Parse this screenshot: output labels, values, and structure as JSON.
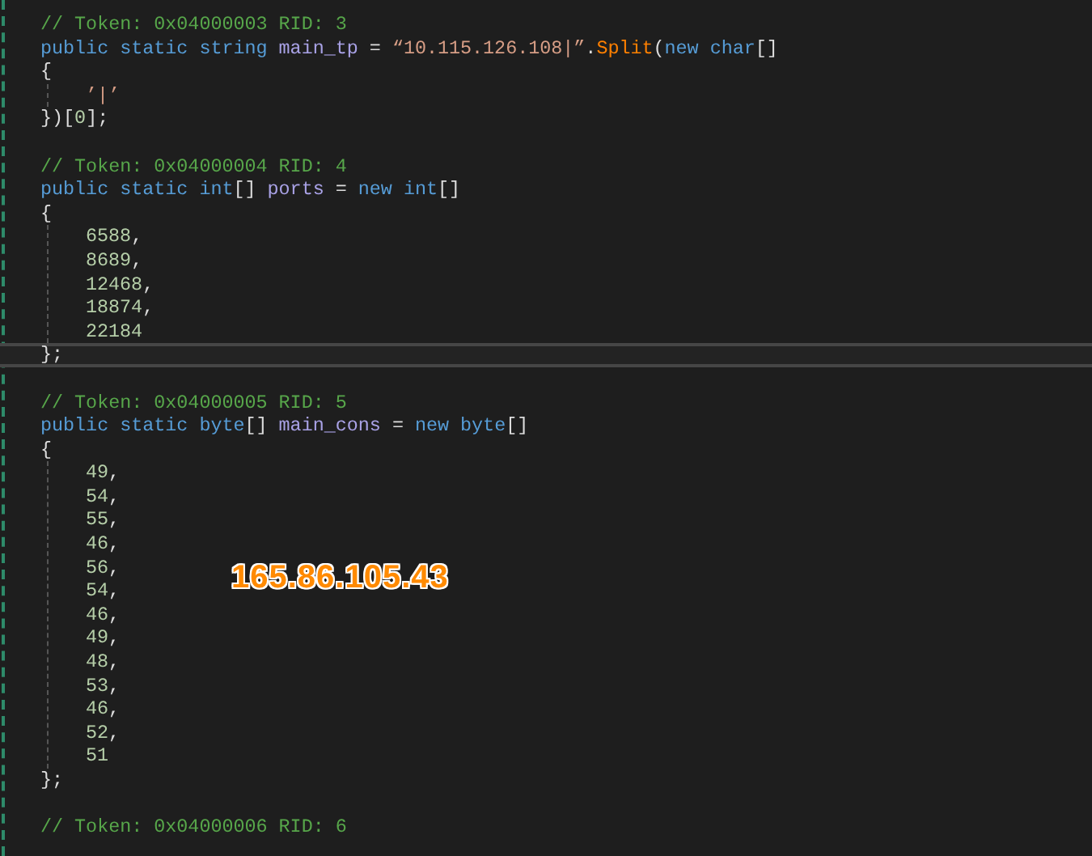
{
  "editor": {
    "blocks": [
      {
        "comment": "// Token: 0x04000003 RID: 3",
        "current": false,
        "declaration": [
          {
            "kind": "keyword",
            "text": "public static string "
          },
          {
            "kind": "field",
            "text": "main_tp "
          },
          {
            "kind": "punct",
            "text": "= "
          },
          {
            "kind": "string",
            "text": "“10.115.126.108|”"
          },
          {
            "kind": "punct",
            "text": "."
          },
          {
            "kind": "method",
            "text": "Split"
          },
          {
            "kind": "punct",
            "text": "("
          },
          {
            "kind": "keyword",
            "text": "new char"
          },
          {
            "kind": "punct",
            "text": "[]"
          }
        ],
        "open": "{",
        "items": [
          [
            {
              "kind": "string",
              "text": "’|’"
            }
          ]
        ],
        "close": [
          {
            "kind": "punct",
            "text": "})["
          },
          {
            "kind": "number",
            "text": "0"
          },
          {
            "kind": "punct",
            "text": "];"
          }
        ]
      },
      {
        "comment": "// Token: 0x04000004 RID: 4",
        "current": true,
        "declaration": [
          {
            "kind": "keyword",
            "text": "public static int"
          },
          {
            "kind": "punct",
            "text": "[] "
          },
          {
            "kind": "field",
            "text": "ports "
          },
          {
            "kind": "punct",
            "text": "= "
          },
          {
            "kind": "keyword",
            "text": "new int"
          },
          {
            "kind": "punct",
            "text": "[]"
          }
        ],
        "open": "{",
        "items": [
          [
            {
              "kind": "number",
              "text": "6588"
            },
            {
              "kind": "punct",
              "text": ","
            }
          ],
          [
            {
              "kind": "number",
              "text": "8689"
            },
            {
              "kind": "punct",
              "text": ","
            }
          ],
          [
            {
              "kind": "number",
              "text": "12468"
            },
            {
              "kind": "punct",
              "text": ","
            }
          ],
          [
            {
              "kind": "number",
              "text": "18874"
            },
            {
              "kind": "punct",
              "text": ","
            }
          ],
          [
            {
              "kind": "number",
              "text": "22184"
            }
          ]
        ],
        "close": [
          {
            "kind": "punct",
            "text": "};"
          }
        ]
      },
      {
        "comment": "// Token: 0x04000005 RID: 5",
        "current": false,
        "declaration": [
          {
            "kind": "keyword",
            "text": "public static byte"
          },
          {
            "kind": "punct",
            "text": "[] "
          },
          {
            "kind": "field",
            "text": "main_cons "
          },
          {
            "kind": "punct",
            "text": "= "
          },
          {
            "kind": "keyword",
            "text": "new byte"
          },
          {
            "kind": "punct",
            "text": "[]"
          }
        ],
        "open": "{",
        "items": [
          [
            {
              "kind": "number",
              "text": "49"
            },
            {
              "kind": "punct",
              "text": ","
            }
          ],
          [
            {
              "kind": "number",
              "text": "54"
            },
            {
              "kind": "punct",
              "text": ","
            }
          ],
          [
            {
              "kind": "number",
              "text": "55"
            },
            {
              "kind": "punct",
              "text": ","
            }
          ],
          [
            {
              "kind": "number",
              "text": "46"
            },
            {
              "kind": "punct",
              "text": ","
            }
          ],
          [
            {
              "kind": "number",
              "text": "56"
            },
            {
              "kind": "punct",
              "text": ","
            }
          ],
          [
            {
              "kind": "number",
              "text": "54"
            },
            {
              "kind": "punct",
              "text": ","
            }
          ],
          [
            {
              "kind": "number",
              "text": "46"
            },
            {
              "kind": "punct",
              "text": ","
            }
          ],
          [
            {
              "kind": "number",
              "text": "49"
            },
            {
              "kind": "punct",
              "text": ","
            }
          ],
          [
            {
              "kind": "number",
              "text": "48"
            },
            {
              "kind": "punct",
              "text": ","
            }
          ],
          [
            {
              "kind": "number",
              "text": "53"
            },
            {
              "kind": "punct",
              "text": ","
            }
          ],
          [
            {
              "kind": "number",
              "text": "46"
            },
            {
              "kind": "punct",
              "text": ","
            }
          ],
          [
            {
              "kind": "number",
              "text": "52"
            },
            {
              "kind": "punct",
              "text": ","
            }
          ],
          [
            {
              "kind": "number",
              "text": "51"
            }
          ]
        ],
        "close": [
          {
            "kind": "punct",
            "text": "};"
          }
        ]
      },
      {
        "comment": "// Token: 0x04000006 RID: 6"
      }
    ]
  },
  "overlay": {
    "text": "165.86.105.43"
  }
}
